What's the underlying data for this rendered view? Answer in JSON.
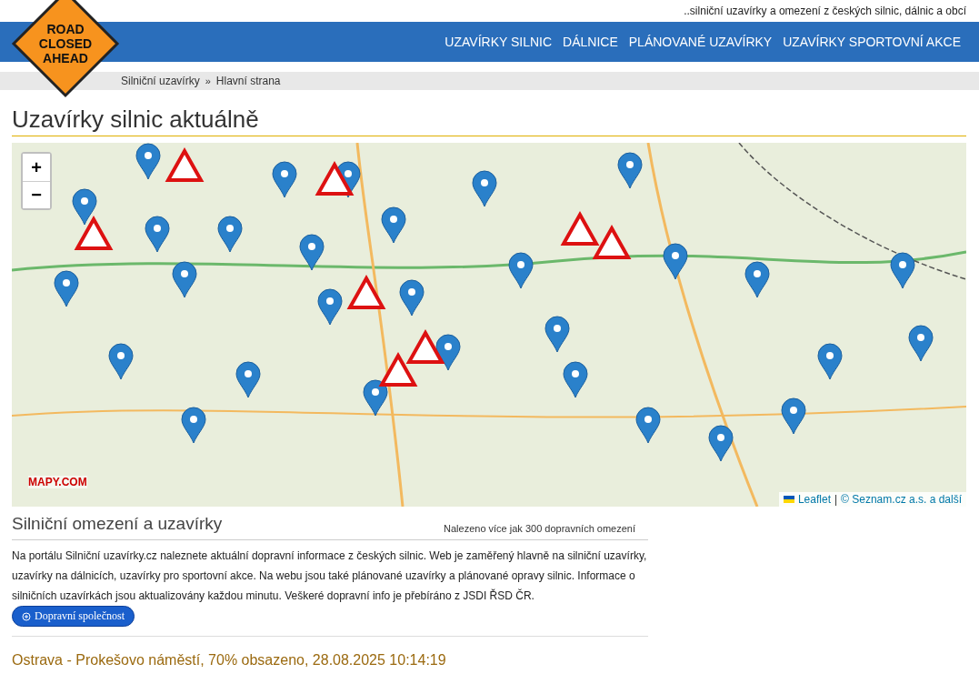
{
  "logo": {
    "lines": [
      "ROAD",
      "CLOSED",
      "AHEAD"
    ]
  },
  "tagline": "..silniční uzavírky a omezení z českých silnic, dálnic a obcí",
  "nav": [
    "UZAVÍRKY SILNIC",
    "DÁLNICE",
    "PLÁNOVANÉ UZAVÍRKY",
    "UZAVÍRKY SPORTOVNÍ AKCE"
  ],
  "breadcrumb": [
    "Silniční uzavírky",
    "»",
    "Hlavní strana"
  ],
  "title": "Uzavírky silnic aktuálně",
  "map": {
    "zoom_in": "+",
    "zoom_out": "−",
    "brand": "MAPY.COM",
    "attribution_link": "Leaflet",
    "attribution_sep": "|",
    "attribution_text": "© Seznam.cz a.s. a další"
  },
  "section": {
    "heading": "Silniční omezení a uzavírky",
    "count": "Nalezeno více jak 300 dopravních omezení",
    "text": "Na portálu Silniční uzavírky.cz naleznete aktuální dopravní informace z českých silnic. Web je zaměřený hlavně na silniční uzavírky, uzavírky na dálnicích, uzavírky pro sportovní akce. Na webu jsou také plánované uzavírky a plánované opravy silnic. Informace o silničních uzavírkách jsou aktualizovány každou minutu. Veškeré dopravní info je přebíráno z JSDI ŘSD ČR.",
    "button": "Dopravní společnost",
    "parking": "Ostrava - Prokešovo náměstí, 70% obsazeno, 28.08.2025 10:14:19"
  }
}
